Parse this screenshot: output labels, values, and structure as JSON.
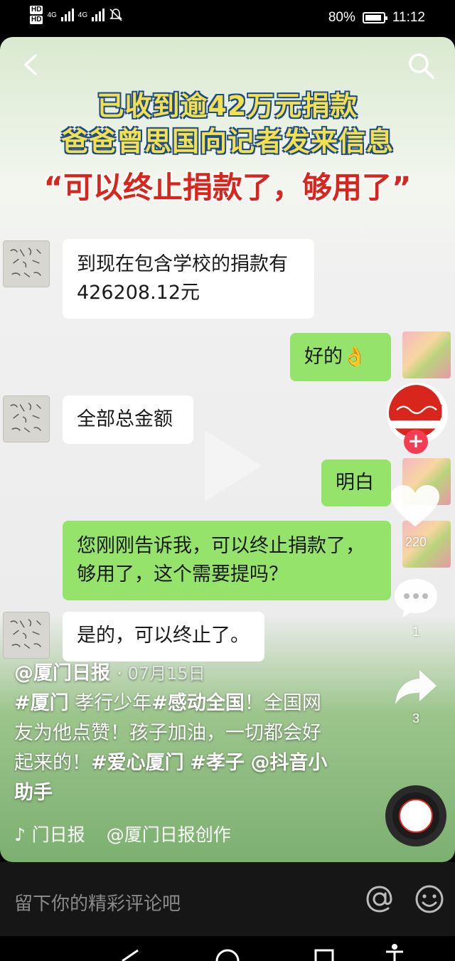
{
  "status_bar": {
    "hd1": "HD",
    "hd2": "HD",
    "net1": "4G",
    "net2": "4G",
    "battery": "80%",
    "time": "11:12"
  },
  "video": {
    "headline_line1": "已收到逾42万元捐款",
    "headline_line2": "爸爸曾思国向记者发来信息",
    "quote": "“可以终止捐款了，够用了”",
    "chat": [
      {
        "side": "left",
        "text": "到现在包含学校的捐款有426208.12元"
      },
      {
        "side": "right",
        "text": "好的👌"
      },
      {
        "side": "left",
        "text": "全部总金额"
      },
      {
        "side": "right",
        "text": "明白"
      },
      {
        "side": "right",
        "text": "您刚刚告诉我，可以终止捐款了，够用了，这个需要提吗？"
      },
      {
        "side": "left",
        "text": "是的，可以终止了。"
      }
    ]
  },
  "actions": {
    "like_count": "220",
    "comment_count": "1",
    "share_count": "3",
    "follow": "+"
  },
  "post": {
    "author": "@厦门日报",
    "date": "· 07月15日",
    "tag1": "#厦门",
    "text1": " 孝行少年",
    "tag2": "#感动全国",
    "text2": "！全国网友为他点赞！孩子加油，一切都会好起来的！",
    "tag3": "#爱心厦门",
    "tag4": "#孝子",
    "mention": "@抖音小助手",
    "music_author": "门日报",
    "music_title": "@厦门日报创作"
  },
  "comment_bar": {
    "placeholder": "留下你的精彩评论吧"
  },
  "colors": {
    "headline_yellow": "#f4e04a",
    "headline_outline": "#1d4b8f",
    "quote_red": "#d9261c",
    "wechat_green": "#95e36a",
    "follow_red": "#f43c52"
  }
}
